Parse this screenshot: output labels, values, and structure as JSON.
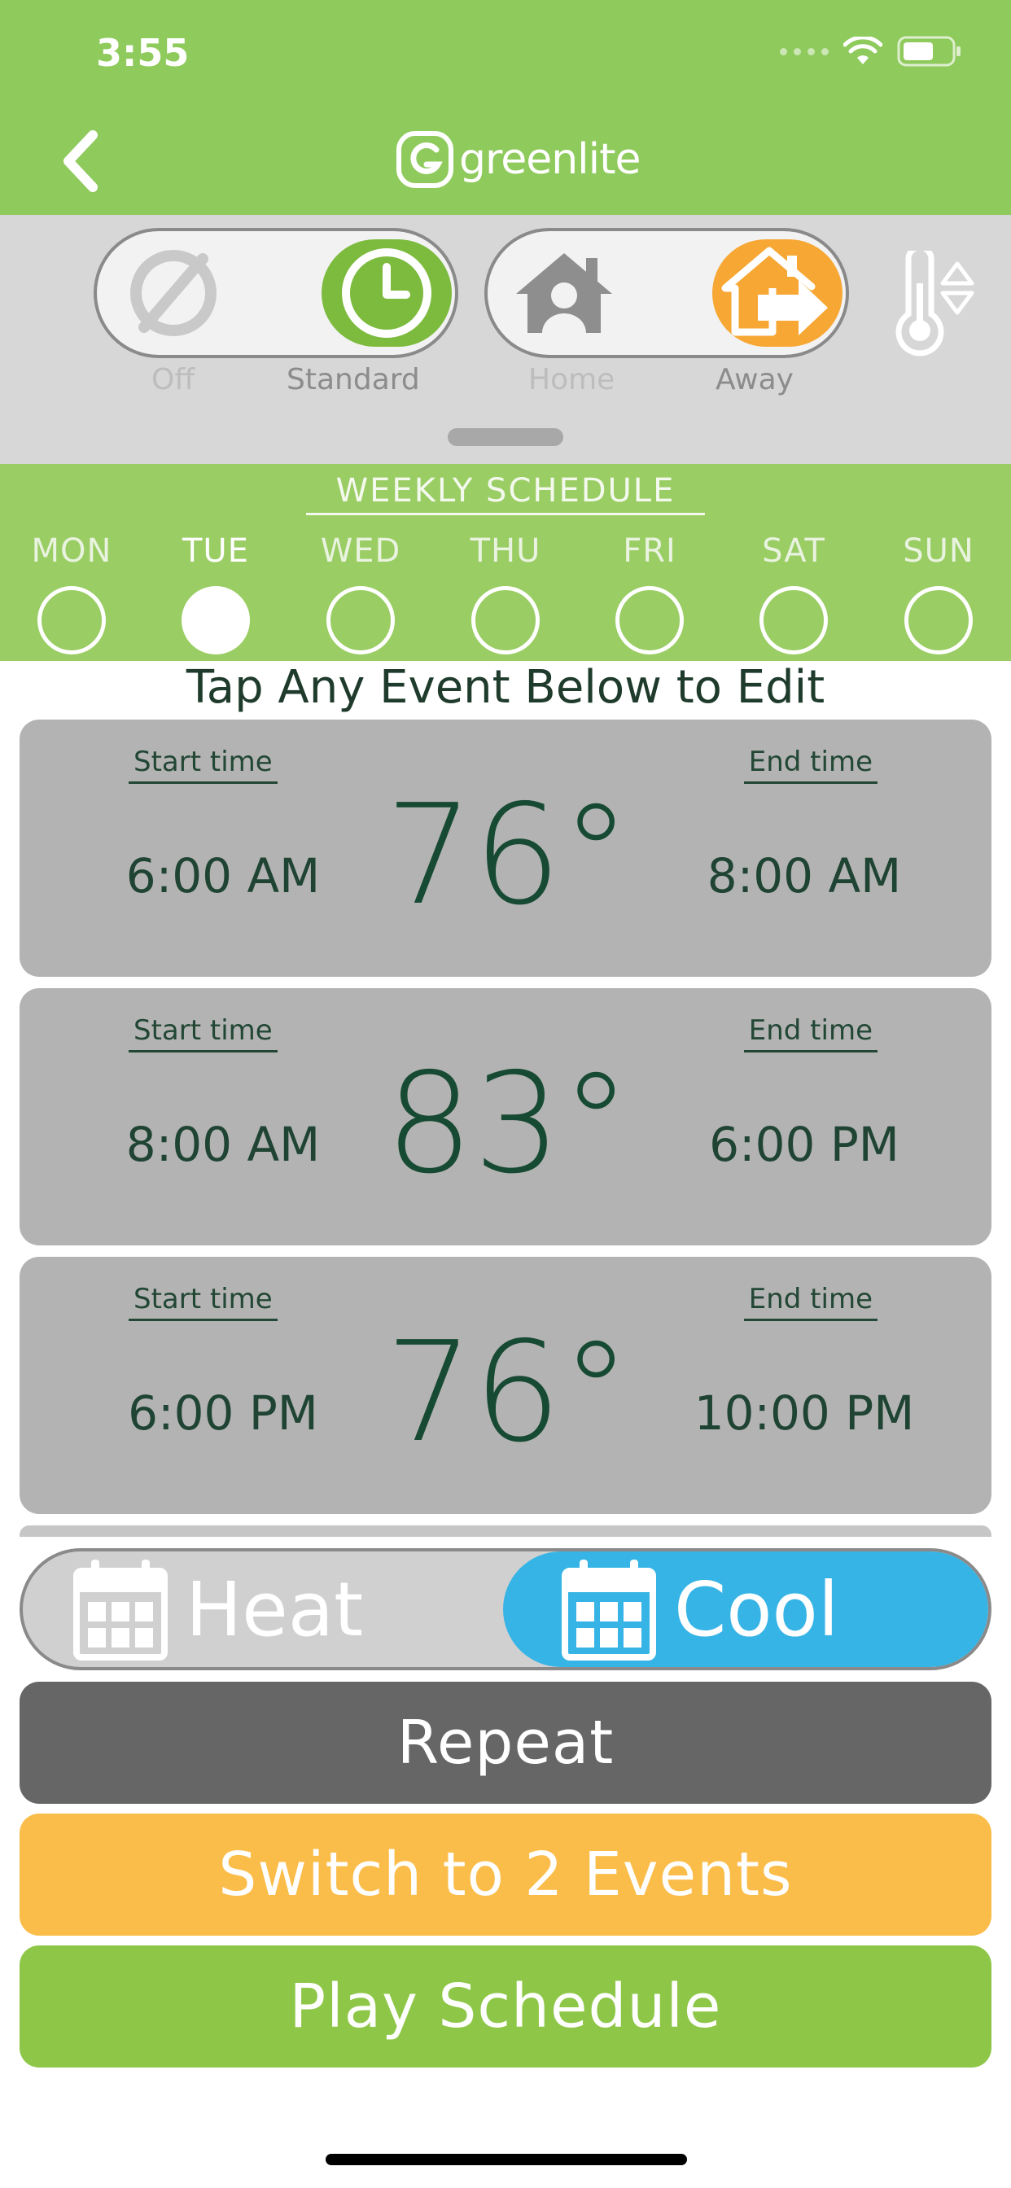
{
  "status_bar": {
    "time": "3:55"
  },
  "header": {
    "logo_text": "greenlite"
  },
  "mode_toggle": {
    "off_label": "Off",
    "standard_label": "Standard"
  },
  "presence_toggle": {
    "home_label": "Home",
    "away_label": "Away"
  },
  "weekly_schedule": {
    "title": "WEEKLY SCHEDULE",
    "days": [
      "MON",
      "TUE",
      "WED",
      "THU",
      "FRI",
      "SAT",
      "SUN"
    ],
    "selected_day": "TUE"
  },
  "hint": "Tap Any Event Below to Edit",
  "events": [
    {
      "start_label": "Start time",
      "end_label": "End time",
      "start": "6:00 AM",
      "temp": "76°",
      "end": "8:00 AM"
    },
    {
      "start_label": "Start time",
      "end_label": "End time",
      "start": "8:00 AM",
      "temp": "83°",
      "end": "6:00 PM"
    },
    {
      "start_label": "Start time",
      "end_label": "End time",
      "start": "6:00 PM",
      "temp": "76°",
      "end": "10:00 PM"
    }
  ],
  "hc_toggle": {
    "heat_label": "Heat",
    "cool_label": "Cool",
    "selected": "Cool"
  },
  "buttons": {
    "repeat": "Repeat",
    "switch": "Switch to 2 Events",
    "play": "Play Schedule"
  },
  "colors": {
    "brand_green": "#8fca5c",
    "cool_blue": "#37b4e6",
    "away_orange": "#f7a734",
    "standard_green": "#7dbb3f"
  }
}
